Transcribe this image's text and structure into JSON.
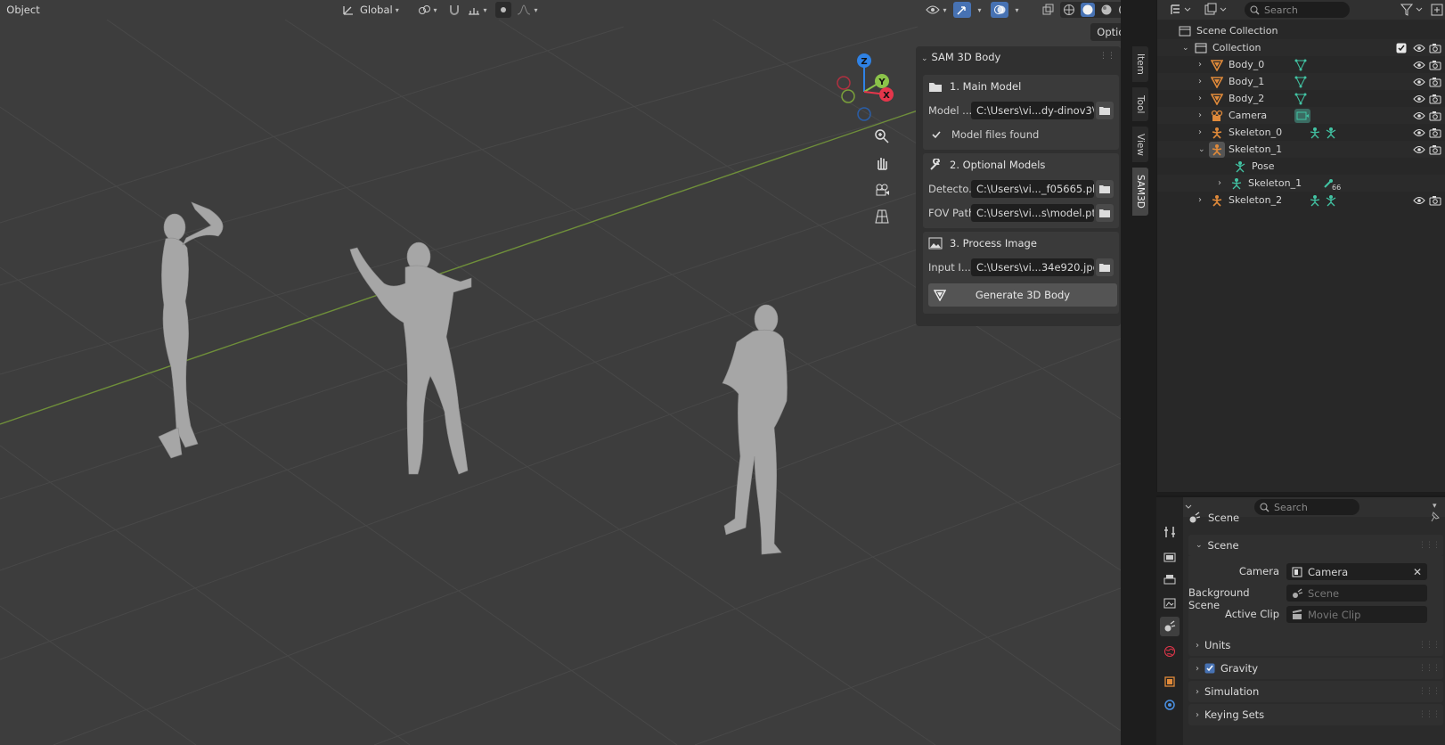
{
  "viewport_header": {
    "mode": "Object",
    "orientation": "Global",
    "options": "Options"
  },
  "gizmo": {
    "z": "Z",
    "y": "Y",
    "x": "X"
  },
  "side_tabs": [
    "Item",
    "Tool",
    "View",
    "SAM3D"
  ],
  "sam_panel": {
    "title": "SAM 3D Body",
    "main_model": {
      "heading": "1. Main Model",
      "label": "Model ...",
      "value": "C:\\Users\\vi...dy-dinov3\\",
      "status": "Model files found"
    },
    "optional_models": {
      "heading": "2. Optional Models",
      "detector_label": "Detecto...",
      "detector_value": "C:\\Users\\vi..._f05665.pkl",
      "fov_label": "FOV Path:",
      "fov_value": "C:\\Users\\vi...s\\model.pt"
    },
    "process_image": {
      "heading": "3. Process Image",
      "input_label": "Input I...",
      "input_value": "C:\\Users\\vi...34e920.jpg",
      "generate_label": "Generate 3D Body"
    }
  },
  "outliner": {
    "search_placeholder": "Search",
    "scene_collection": "Scene Collection",
    "rows": [
      {
        "label": "Collection"
      },
      {
        "label": "Body_0"
      },
      {
        "label": "Body_1"
      },
      {
        "label": "Body_2"
      },
      {
        "label": "Camera"
      },
      {
        "label": "Skeleton_0"
      },
      {
        "label": "Skeleton_1"
      },
      {
        "label": "Pose"
      },
      {
        "label": "Skeleton_1",
        "badge": "66"
      },
      {
        "label": "Skeleton_2"
      }
    ]
  },
  "properties": {
    "search_placeholder": "Search",
    "context": "Scene",
    "section_scene": "Scene",
    "camera_label": "Camera",
    "camera_value": "Camera",
    "background_label": "Background Scene",
    "background_placeholder": "Scene",
    "clip_label": "Active Clip",
    "clip_placeholder": "Movie Clip",
    "sections": [
      "Units",
      "Gravity",
      "Simulation",
      "Keying Sets"
    ]
  },
  "colors": {
    "accent_blue": "#4772b3",
    "teal_icon": "#42c4a4",
    "orange_icon": "#e08a3a",
    "x_red": "#e5364b",
    "y_green": "#8bc34a",
    "z_blue": "#2f82e5"
  }
}
